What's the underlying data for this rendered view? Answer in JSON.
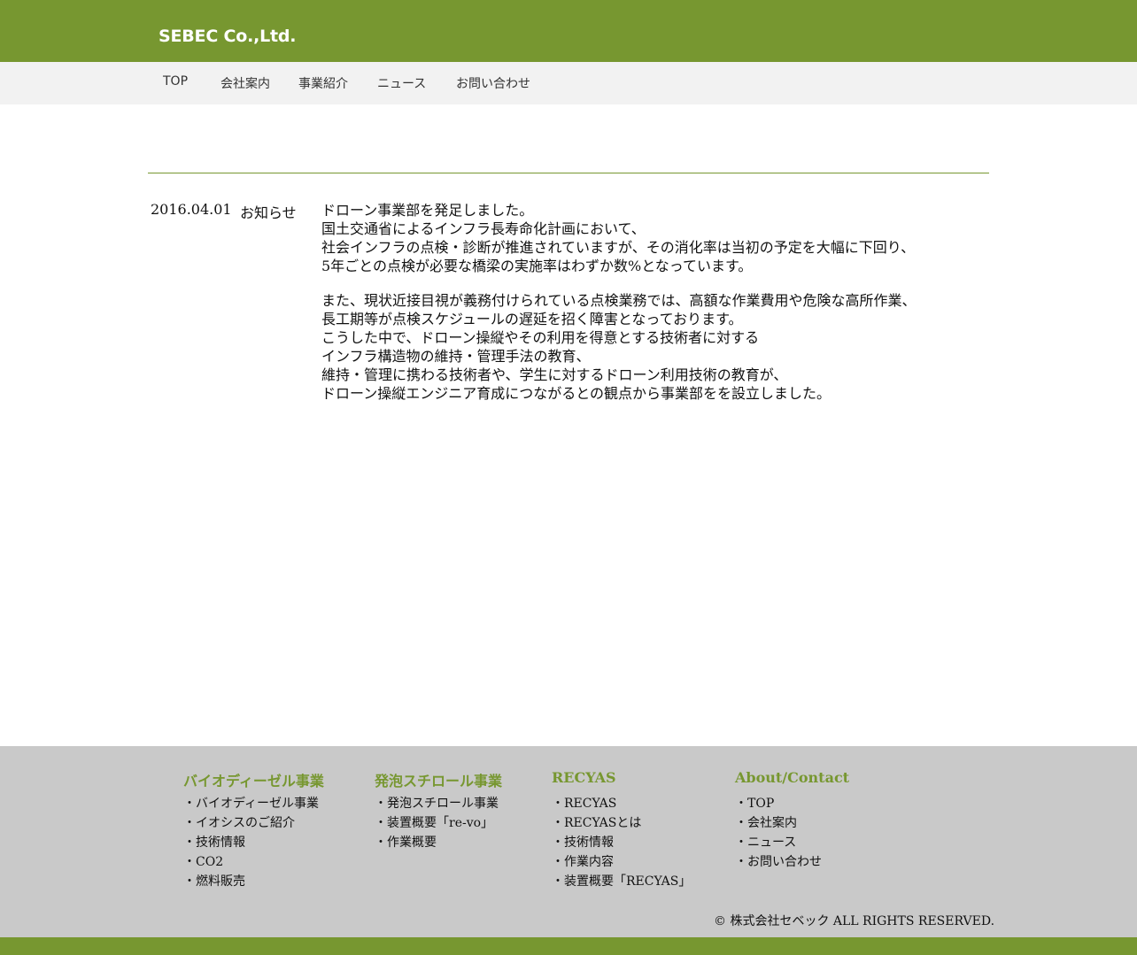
{
  "header": {
    "logo": "SEBEC Co.,Ltd."
  },
  "nav": [
    "TOP",
    "会社案内",
    "事業紹介",
    "ニュース",
    "お問い合わせ"
  ],
  "news": {
    "date": "2016.04.01",
    "category": "お知らせ",
    "paragraphs": [
      [
        "ドローン事業部を発足しました。",
        "国土交通省によるインフラ長寿命化計画において、",
        "社会インフラの点検・診断が推進されていますが、その消化率は当初の予定を大幅に下回り、",
        "5年ごとの点検が必要な橋梁の実施率はわずか数%となっています。"
      ],
      [
        "また、現状近接目視が義務付けられている点検業務では、高額な作業費用や危険な高所作業、",
        "長工期等が点検スケジュールの遅延を招く障害となっております。",
        "こうした中で、ドローン操縦やその利用を得意とする技術者に対する",
        "インフラ構造物の維持・管理手法の教育、",
        "維持・管理に携わる技術者や、学生に対するドローン利用技術の教育が、",
        "ドローン操縦エンジニア育成につながるとの観点から事業部をを設立しました。"
      ]
    ]
  },
  "footer": {
    "columns": [
      {
        "heading": "バイオディーゼル事業",
        "links": [
          "・バイオディーゼル事業",
          "・イオシスのご紹介",
          "・技術情報",
          "・CO2",
          "・燃料販売"
        ]
      },
      {
        "heading": "発泡スチロール事業",
        "links": [
          "・発泡スチロール事業",
          "・装置概要「re-vo」",
          "・作業概要"
        ]
      },
      {
        "heading": "RECYAS",
        "links": [
          "・RECYAS",
          "・RECYASとは",
          "・技術情報",
          "・作業内容",
          "・装置概要「RECYAS」"
        ]
      },
      {
        "heading": "About/Contact",
        "links": [
          "・TOP",
          "・会社案内",
          "・ニュース",
          "・お問い合わせ"
        ]
      }
    ],
    "copyright": "© 株式会社セベック ALL RIGHTS RESERVED."
  },
  "colors": {
    "brand_green": "#779730",
    "nav_bg": "#f2f2f2",
    "footer_bg": "#c9c9c9"
  }
}
